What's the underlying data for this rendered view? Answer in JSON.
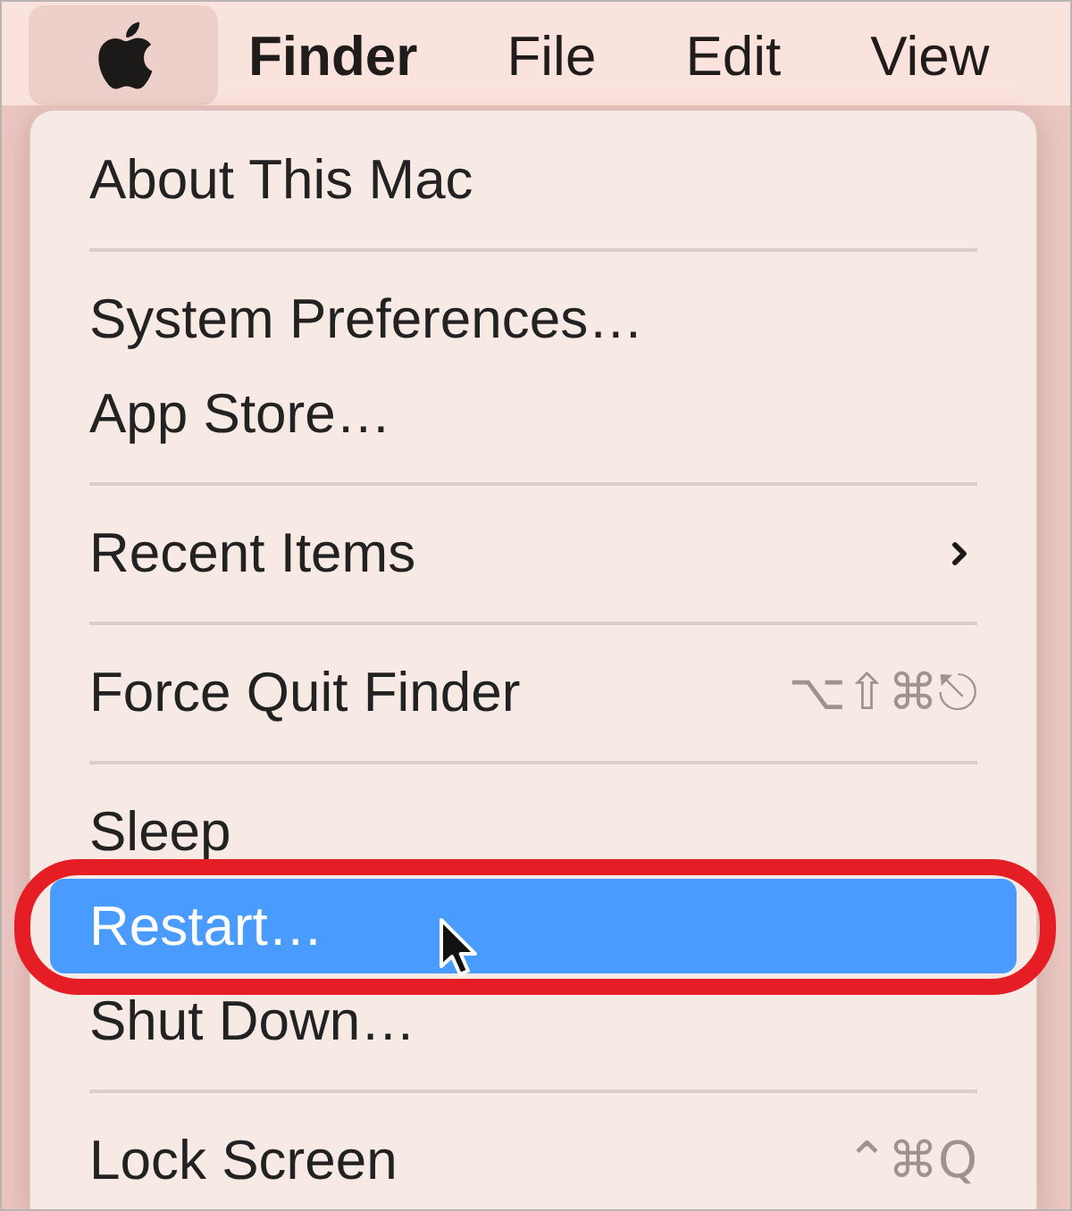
{
  "menu_bar": [
    {
      "kind": "apple",
      "selected": true
    },
    {
      "kind": "app",
      "label": "Finder",
      "selected": false
    },
    {
      "kind": "menu",
      "label": "File",
      "selected": false
    },
    {
      "kind": "menu",
      "label": "Edit",
      "selected": false
    },
    {
      "kind": "menu",
      "label": "View",
      "selected": false
    }
  ],
  "menu": {
    "items": [
      {
        "kind": "item",
        "label": "About This Mac",
        "selected": false,
        "submenu": false,
        "circled": false
      },
      {
        "kind": "separator"
      },
      {
        "kind": "item",
        "label": "System Preferences…",
        "selected": false,
        "submenu": false,
        "circled": false
      },
      {
        "kind": "item",
        "label": "App Store…",
        "selected": false,
        "submenu": false,
        "circled": false
      },
      {
        "kind": "separator"
      },
      {
        "kind": "item",
        "label": "Recent Items",
        "selected": false,
        "submenu": true,
        "circled": false
      },
      {
        "kind": "separator"
      },
      {
        "kind": "item",
        "label": "Force Quit Finder",
        "shortcut": "⌥⇧⌘⎋",
        "selected": false,
        "submenu": false,
        "circled": false
      },
      {
        "kind": "separator"
      },
      {
        "kind": "item",
        "label": "Sleep",
        "selected": false,
        "submenu": false,
        "circled": false
      },
      {
        "kind": "item",
        "label": "Restart…",
        "selected": true,
        "submenu": false,
        "circled": true
      },
      {
        "kind": "item",
        "label": "Shut Down…",
        "selected": false,
        "submenu": false,
        "circled": false
      },
      {
        "kind": "separator"
      },
      {
        "kind": "item",
        "label": "Lock Screen",
        "shortcut": "⌃⌘Q",
        "selected": false,
        "submenu": false,
        "circled": false
      }
    ]
  }
}
